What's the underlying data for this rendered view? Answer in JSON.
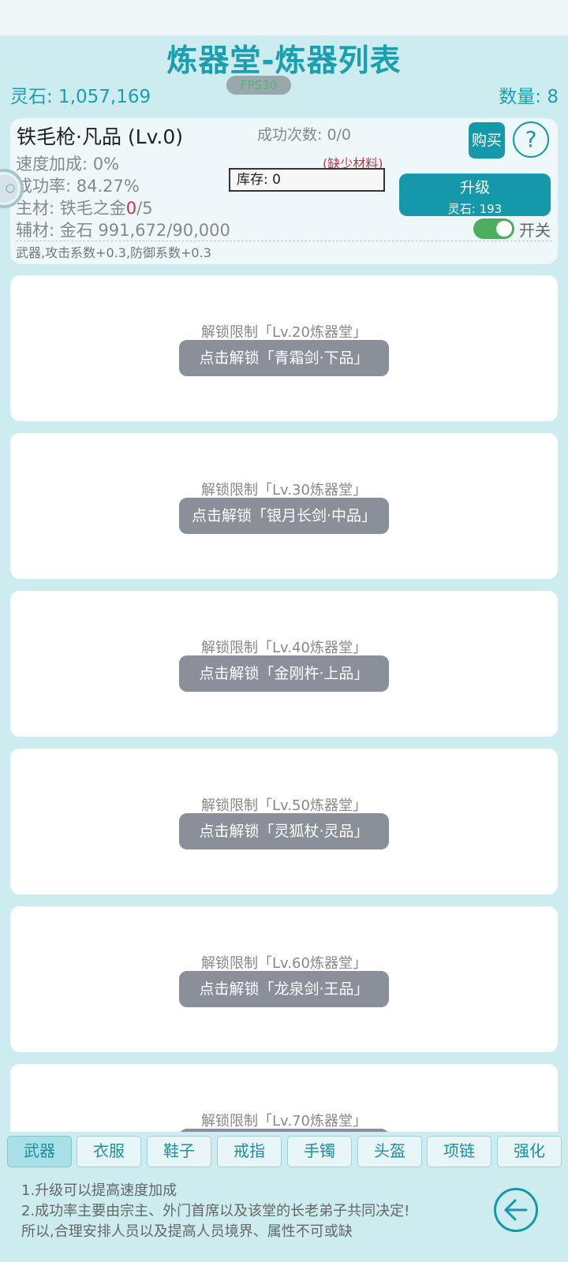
{
  "header": {
    "title": "炼器堂-炼器列表",
    "fps": "FPS30",
    "stone_total": "灵石: 1,057,169",
    "count_total": "数量: 8"
  },
  "item": {
    "name": "铁毛枪·凡品 (Lv.0)",
    "success_count": "成功次数: 0/0",
    "buy_label": "购买",
    "help_label": "?",
    "speed_bonus": "速度加成: 0%",
    "success_rate": "成功率: 84.27%",
    "main_mat_prefix": "主材: 铁毛之金",
    "main_mat_have": "0",
    "main_mat_need": "/5",
    "aux_mat": "辅材: 金石 991,672/90,000",
    "missing_material": "(缺少材料)",
    "stock": "库存: 0",
    "upgrade_label": "升级",
    "upgrade_cost": "灵石: 193",
    "toggle_label": "开关",
    "toggle_on": true,
    "description": "武器,攻击系数+0.3,防御系数+0.3"
  },
  "locked_items": [
    {
      "requirement": "解锁限制「Lv.20炼器堂」",
      "unlock_label": "点击解锁「青霜剑·下品」"
    },
    {
      "requirement": "解锁限制「Lv.30炼器堂」",
      "unlock_label": "点击解锁「银月长剑·中品」"
    },
    {
      "requirement": "解锁限制「Lv.40炼器堂」",
      "unlock_label": "点击解锁「金刚杵·上品」"
    },
    {
      "requirement": "解锁限制「Lv.50炼器堂」",
      "unlock_label": "点击解锁「灵狐杖·灵品」"
    },
    {
      "requirement": "解锁限制「Lv.60炼器堂」",
      "unlock_label": "点击解锁「龙泉剑·王品」"
    },
    {
      "requirement": "解锁限制「Lv.70炼器堂」",
      "unlock_label": ""
    }
  ],
  "tabs": [
    {
      "label": "武器",
      "active": true
    },
    {
      "label": "衣服",
      "active": false
    },
    {
      "label": "鞋子",
      "active": false
    },
    {
      "label": "戒指",
      "active": false
    },
    {
      "label": "手镯",
      "active": false
    },
    {
      "label": "头盔",
      "active": false
    },
    {
      "label": "项链",
      "active": false
    },
    {
      "label": "强化",
      "active": false
    }
  ],
  "tips": [
    "1.升级可以提高速度加成",
    "2.成功率主要由宗主、外门首席以及该堂的长老弟子共同决定!",
    "所以,合理安排人员以及提高人员境界、属性不可或缺"
  ],
  "icons": {
    "back": "left-arrow-circle-icon",
    "side": "side-handle-icon"
  }
}
